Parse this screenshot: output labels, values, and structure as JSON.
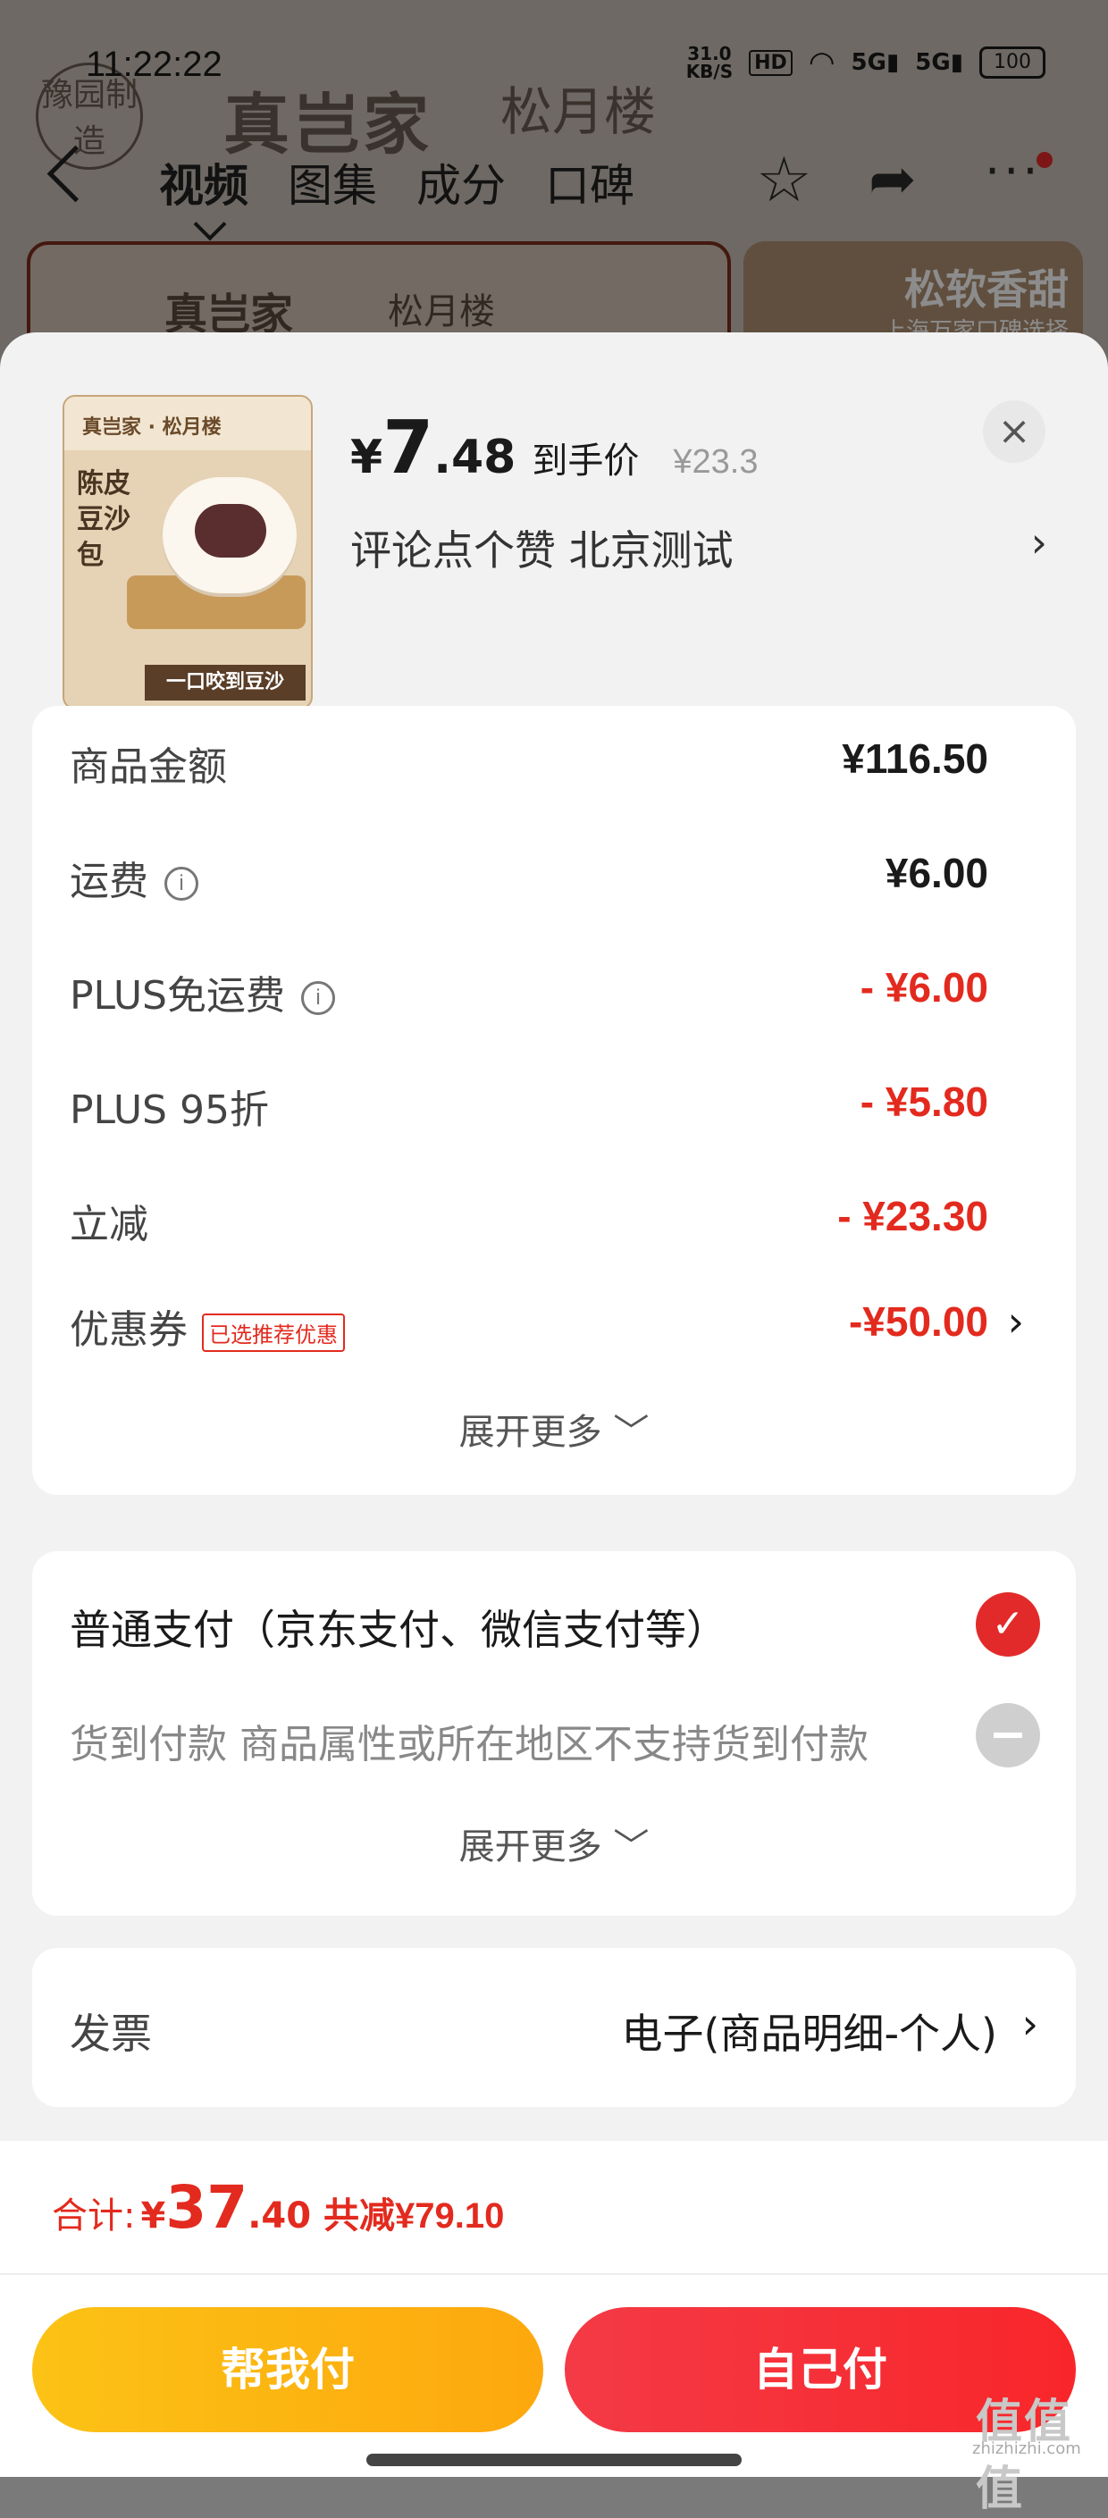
{
  "status_bar": {
    "time": "11:22:22",
    "net_speed_value": "31.0",
    "net_speed_unit": "KB/S",
    "hd": "HD",
    "sig1": "5G",
    "sig2": "5G",
    "battery": "100"
  },
  "background": {
    "brand_badge": "豫园制造",
    "brand_name": "真岂家",
    "brand_name2": "松月楼",
    "nav_tabs": [
      "视频",
      "图集",
      "成分",
      "口碑"
    ],
    "banner_left_text": "真岂家",
    "banner_left_text2": "松月楼",
    "banner_right_title": "松软香甜",
    "banner_right_sub": "上海万家口碑选择",
    "icons": {
      "back": "back-chevron-icon",
      "star": "star-icon",
      "share": "share-icon",
      "more": "more-dots-icon"
    }
  },
  "product": {
    "thumb_brand": "真岂家 · 松月楼",
    "thumb_name": "陈皮豆沙包",
    "thumb_slogan": "一口咬到豆沙",
    "price_symbol": "¥",
    "price_int": "7",
    "price_dec": ".48",
    "price_label": "到手价",
    "original_price": "¥23.3",
    "spec_text": "评论点个赞  北京测试",
    "spec_chevron": "›",
    "close_icon": "×"
  },
  "cost_breakdown": {
    "rows": [
      {
        "label": "商品金额",
        "value": "¥116.50",
        "red": false,
        "info": false
      },
      {
        "label": "运费",
        "value": "¥6.00",
        "red": false,
        "info": true
      },
      {
        "label": "PLUS免运费",
        "value": "- ¥6.00",
        "red": true,
        "info": true
      },
      {
        "label": "PLUS 95折",
        "value": "- ¥5.80",
        "red": true,
        "info": false
      },
      {
        "label": "立减",
        "value": "- ¥23.30",
        "red": true,
        "info": false
      }
    ],
    "coupon": {
      "label": "优惠券",
      "badge": "已选推荐优惠",
      "value": "-¥50.00",
      "chevron": "›"
    },
    "expand_label": "展开更多 ﹀"
  },
  "payment": {
    "normal": "普通支付（京东支付、微信支付等）",
    "cod": "货到付款 商品属性或所在地区不支持货到付款",
    "check_glyph": "✓",
    "expand_label": "展开更多 ﹀"
  },
  "invoice": {
    "label": "发票",
    "value": "电子(商品明细-个人)",
    "chevron": "›"
  },
  "footer": {
    "total_label": "合计:",
    "total_symbol": "¥",
    "total_int": "37",
    "total_dec": ".40",
    "saved_label": "共减",
    "saved_value": "¥79.10",
    "help_pay": "帮我付",
    "self_pay": "自己付"
  },
  "watermark": {
    "site": "zhizhizhi.com",
    "mark": "值值值"
  },
  "colors": {
    "accent_red": "#e32a1e",
    "button_yellow": "#fdb510",
    "button_red": "#f52e36"
  }
}
